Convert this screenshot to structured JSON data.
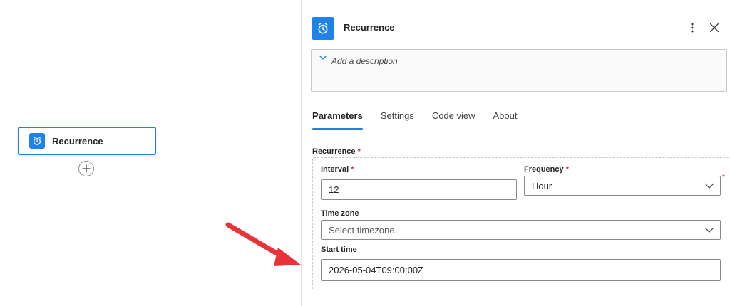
{
  "canvas": {
    "node": {
      "label": "Recurrence",
      "icon": "alarm-clock-icon"
    },
    "add_icon": "plus-circle-icon"
  },
  "panel": {
    "title": "Recurrence",
    "icon": "alarm-clock-icon",
    "description_placeholder": "Add a description",
    "tabs": [
      {
        "label": "Parameters",
        "active": true
      },
      {
        "label": "Settings",
        "active": false
      },
      {
        "label": "Code view",
        "active": false
      },
      {
        "label": "About",
        "active": false
      }
    ],
    "parameters": {
      "section_label": "Recurrence",
      "required_mark": "*",
      "interval": {
        "label": "Interval",
        "value": "12"
      },
      "frequency": {
        "label": "Frequency",
        "value": "Hour"
      },
      "time_zone": {
        "label": "Time zone",
        "placeholder": "Select timezone."
      },
      "start_time": {
        "label": "Start time",
        "value": "2026-05-04T09:00:00Z"
      }
    }
  },
  "colors": {
    "accent": "#2b7cd3",
    "icon_bg": "#1e82e6",
    "required": "#c4314b",
    "annotation_arrow": "#e8333a"
  }
}
